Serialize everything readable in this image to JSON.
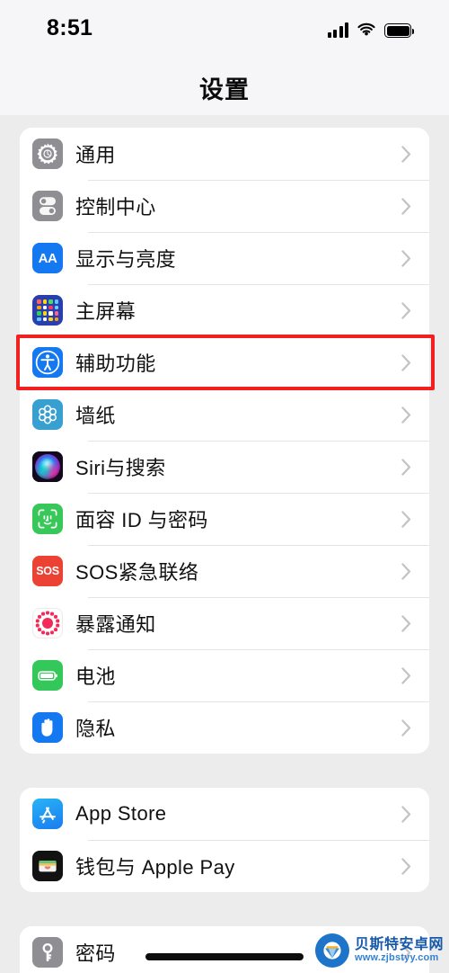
{
  "status_bar": {
    "time": "8:51",
    "signal_icon": "cellular-signal-icon",
    "wifi_icon": "wifi-icon",
    "battery_icon": "battery-icon"
  },
  "nav": {
    "title": "设置"
  },
  "groups": [
    {
      "id": "group-system",
      "rows": [
        {
          "label": "通用",
          "icon": "gear-icon",
          "icon_class": "ico-general"
        },
        {
          "label": "控制中心",
          "icon": "control-center-icon",
          "icon_class": "ico-control"
        },
        {
          "label": "显示与亮度",
          "icon": "display-brightness-icon",
          "icon_class": "ico-display"
        },
        {
          "label": "主屏幕",
          "icon": "home-screen-icon",
          "icon_class": "ico-home"
        },
        {
          "label": "辅助功能",
          "icon": "accessibility-icon",
          "icon_class": "ico-access"
        },
        {
          "label": "墙纸",
          "icon": "wallpaper-icon",
          "icon_class": "ico-wall"
        },
        {
          "label": "Siri与搜索",
          "icon": "siri-icon",
          "icon_class": "ico-siri"
        },
        {
          "label": "面容 ID 与密码",
          "icon": "face-id-icon",
          "icon_class": "ico-faceid"
        },
        {
          "label": "SOS紧急联络",
          "icon": "sos-icon",
          "icon_class": "ico-sos"
        },
        {
          "label": "暴露通知",
          "icon": "exposure-notification-icon",
          "icon_class": "ico-expo"
        },
        {
          "label": "电池",
          "icon": "battery-settings-icon",
          "icon_class": "ico-battery"
        },
        {
          "label": "隐私",
          "icon": "privacy-hand-icon",
          "icon_class": "ico-privacy"
        }
      ]
    },
    {
      "id": "group-store",
      "rows": [
        {
          "label": "App Store",
          "icon": "app-store-icon",
          "icon_class": "ico-appstore"
        },
        {
          "label": "钱包与 Apple Pay",
          "icon": "wallet-icon",
          "icon_class": "ico-wallet"
        }
      ]
    },
    {
      "id": "group-accounts",
      "rows": [
        {
          "label": "密码",
          "icon": "key-icon",
          "icon_class": "ico-passwd"
        }
      ]
    }
  ],
  "highlight": {
    "target_label": "辅助功能",
    "color": "#f32020"
  },
  "watermark": {
    "name": "贝斯特安卓网",
    "url": "www.zjbstyy.com"
  },
  "colors": {
    "page_background": "#ececed",
    "card_background": "#ffffff",
    "separator": "#e4e4e6",
    "label_text": "#111111",
    "chevron": "#c2c2c7",
    "accent_blue": "#1478f0"
  }
}
